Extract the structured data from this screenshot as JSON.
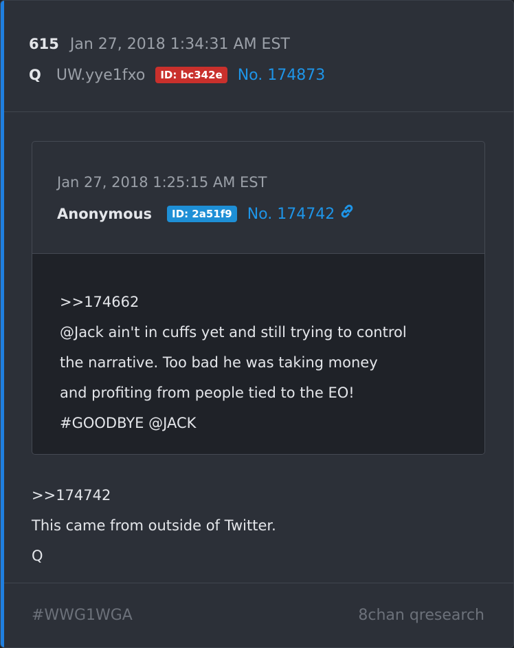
{
  "post": {
    "count": "615",
    "date": "Jan 27, 2018 1:34:31 AM EST",
    "author": "Q",
    "tripcode": "UW.yye1fxo",
    "id_badge": "ID: bc342e",
    "post_no": "No. 174873",
    "body_lines": [
      ">>174742",
      "This came from outside of Twitter.",
      "Q"
    ]
  },
  "quoted_post": {
    "date": "Jan 27, 2018 1:25:15 AM EST",
    "author": "Anonymous",
    "id_badge": "ID: 2a51f9",
    "post_no": "No. 174742",
    "link_icon": "link-icon",
    "body_lines": [
      ">>174662",
      "@Jack ain't in cuffs yet and still trying to control",
      "the narrative. Too bad he was taking money",
      "and profiting from people tied to the EO!",
      "#GOODBYE @JACK"
    ]
  },
  "footer": {
    "hashtag": "#WWG1WGA",
    "source": "8chan qresearch"
  },
  "colors": {
    "accent": "#1f7fe0",
    "id_badge_red": "#c9302c",
    "id_badge_blue": "#1e8fd6",
    "link": "#1e95e8",
    "card_background": "#2c3038",
    "quote_body_background": "#1f2228"
  }
}
